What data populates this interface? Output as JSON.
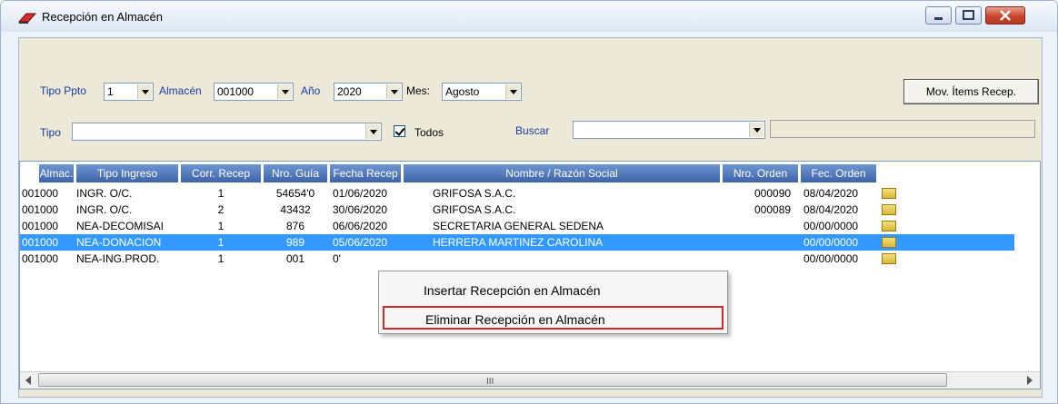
{
  "window": {
    "title": "Recepción en Almacén",
    "icons": {
      "app": "eraser-icon",
      "minimize": "minimize-icon",
      "maximize": "maximize-icon",
      "close": "close-icon"
    }
  },
  "filters": {
    "tipo_ppto_label": "Tipo Ppto",
    "tipo_ppto_value": "1",
    "almacen_label": "Almacén",
    "almacen_value": "001000",
    "anio_label": "Año",
    "anio_value": "2020",
    "mes_label": "Mes:",
    "mes_value": "Agosto",
    "mov_button": "Mov. Ítems Recep.",
    "tipo_label": "Tipo",
    "tipo_value": "",
    "todos_label": "Todos",
    "todos_checked": true,
    "buscar_label": "Buscar",
    "buscar_value": "",
    "buscar_text": ""
  },
  "grid": {
    "columns": [
      "Almac.",
      "Tipo Ingreso",
      "Corr. Recep",
      "Nro. Guía",
      "Fecha Recep",
      "Nombre / Razón Social",
      "Nro. Orden",
      "Fec. Orden"
    ],
    "rows": [
      {
        "almac": "001000",
        "tipo": "INGR. O/C.",
        "corr": "1",
        "guia": "54654'0",
        "fecha": "01/06/2020",
        "nombre": "GRIFOSA S.A.C.",
        "orden": "000090",
        "fec_orden": "08/04/2020",
        "selected": false
      },
      {
        "almac": "001000",
        "tipo": "INGR. O/C.",
        "corr": "2",
        "guia": "43432",
        "fecha": "30/06/2020",
        "nombre": "GRIFOSA S.A.C.",
        "orden": "000089",
        "fec_orden": "08/04/2020",
        "selected": false
      },
      {
        "almac": "001000",
        "tipo": "NEA-DECOMISAI",
        "corr": "1",
        "guia": "876",
        "fecha": "06/06/2020",
        "nombre": "SECRETARIA GENERAL SEDENA",
        "orden": "",
        "fec_orden": "00/00/0000",
        "selected": false
      },
      {
        "almac": "001000",
        "tipo": "NEA-DONACION",
        "corr": "1",
        "guia": "989",
        "fecha": "05/06/2020",
        "nombre": "HERRERA MARTINEZ CAROLINA",
        "orden": "",
        "fec_orden": "00/00/0000",
        "selected": true
      },
      {
        "almac": "001000",
        "tipo": "NEA-ING.PROD.",
        "corr": "1",
        "guia": "001",
        "fecha": "0'",
        "nombre": "",
        "orden": "",
        "fec_orden": "00/00/0000",
        "selected": false
      }
    ],
    "row_icon": "folder-icon",
    "scroll_grip": "III"
  },
  "context_menu": {
    "items": [
      "Insertar Recepción en Almacén",
      "Eliminar Recepción en Almacén"
    ],
    "highlight_color": "#d12a2a"
  },
  "colors": {
    "header_bg": "#5a80c0",
    "selection": "#3399ff",
    "label_blue": "#1a3ba0"
  }
}
